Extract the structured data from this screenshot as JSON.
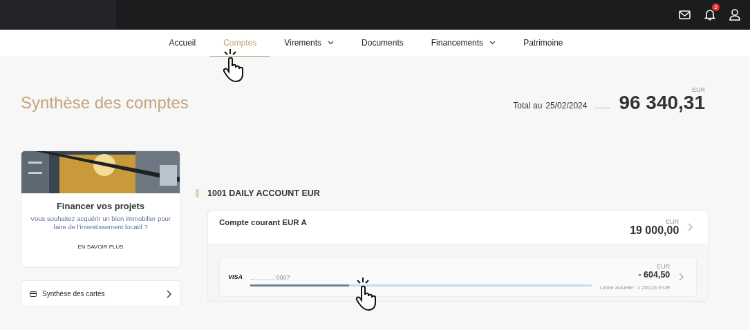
{
  "top_bar": {
    "notifications_badge": "2"
  },
  "nav": [
    {
      "label": "Accueil",
      "selected": false,
      "kind": "link"
    },
    {
      "label": "Comptes",
      "selected": true,
      "kind": "link"
    },
    {
      "label": "Virements",
      "selected": false,
      "kind": "menu"
    },
    {
      "label": "Documents",
      "selected": false,
      "kind": "link"
    },
    {
      "label": "Financements",
      "selected": false,
      "kind": "menu"
    },
    {
      "label": "Patrimoine",
      "selected": false,
      "kind": "link"
    }
  ],
  "page_title": "Synthèse des comptes",
  "total": {
    "label": "Total au",
    "date": "25/02/2024",
    "currency": "EUR",
    "amount": "96 340,31"
  },
  "promo": {
    "kind": "picture",
    "title": "Financer vos projets",
    "text": "Vous souhaitez acquérir un bien immobilier pour faire de l'investissement locatif ?",
    "link": "EN SAVOIR PLUS"
  },
  "cards_link": "Synthèse des cartes",
  "account_group": {
    "title": "1001 DAILY ACCOUNT EUR",
    "account": {
      "name": "Compte courant EUR A",
      "currency": "EUR",
      "amount": "19 000,00"
    },
    "card": {
      "brand": "VISA",
      "number": ".... .... .... 0007",
      "currency": "EUR",
      "amount": "- 604,50",
      "limit": "Limite actuelle : 1 250,00 EUR",
      "level": 0.29
    }
  }
}
